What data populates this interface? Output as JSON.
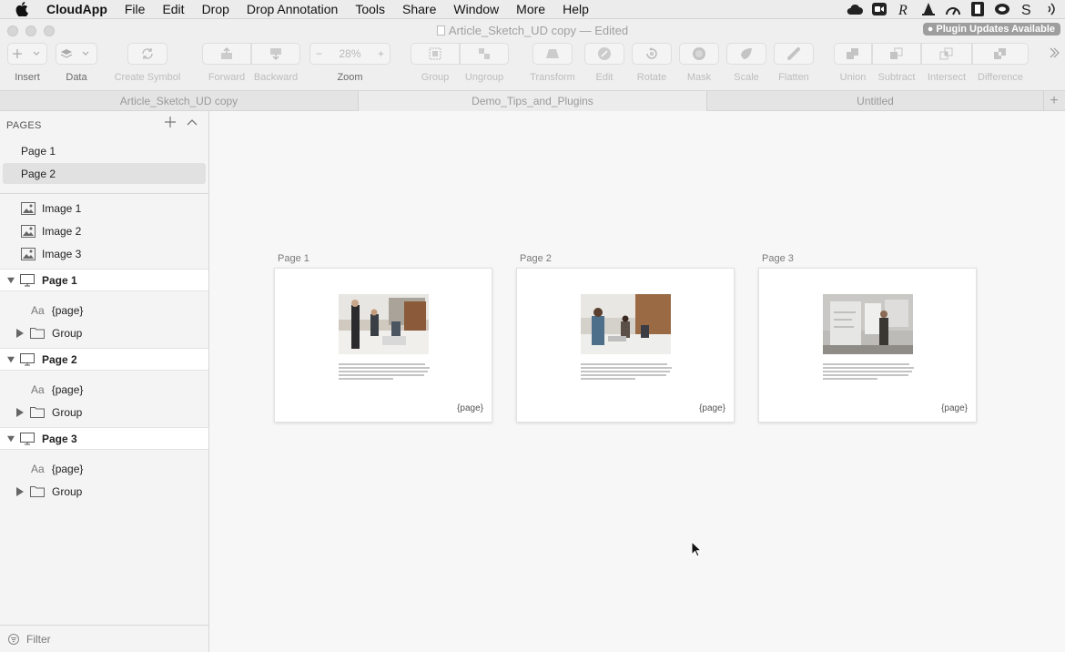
{
  "menubar": {
    "app_name": "CloudApp",
    "items": [
      "File",
      "Edit",
      "Drop",
      "Drop Annotation",
      "Tools",
      "Share",
      "Window",
      "More",
      "Help"
    ]
  },
  "window": {
    "title": "Article_Sketch_UD copy — Edited",
    "plugin_badge": "Plugin Updates Available"
  },
  "toolbar": {
    "insert": "Insert",
    "data": "Data",
    "create_symbol": "Create Symbol",
    "forward": "Forward",
    "backward": "Backward",
    "zoom_value": "28%",
    "zoom_minus": "−",
    "zoom_plus": "+",
    "zoom": "Zoom",
    "group": "Group",
    "ungroup": "Ungroup",
    "transform": "Transform",
    "edit": "Edit",
    "rotate": "Rotate",
    "mask": "Mask",
    "scale": "Scale",
    "flatten": "Flatten",
    "union": "Union",
    "subtract": "Subtract",
    "intersect": "Intersect",
    "difference": "Difference"
  },
  "tabs": {
    "t1": "Article_Sketch_UD copy",
    "t2": "Demo_Tips_and_Plugins",
    "t3": "Untitled",
    "active": "Demo_Tips_and_Plugins"
  },
  "sidebar": {
    "pages_header": "PAGES",
    "pages": [
      {
        "label": "Page 1",
        "selected": false
      },
      {
        "label": "Page 2",
        "selected": true
      }
    ],
    "images": [
      "Image 1",
      "Image 2",
      "Image 3"
    ],
    "artboards": [
      {
        "label": "Page 1",
        "text_layer": "{page}",
        "group": "Group"
      },
      {
        "label": "Page 2",
        "text_layer": "{page}",
        "group": "Group"
      },
      {
        "label": "Page 3",
        "text_layer": "{page}",
        "group": "Group"
      }
    ],
    "filter_placeholder": "Filter"
  },
  "canvas": {
    "artboards": [
      {
        "label": "Page 1",
        "tag": "{page}"
      },
      {
        "label": "Page 2",
        "tag": "{page}"
      },
      {
        "label": "Page 3",
        "tag": "{page}"
      }
    ]
  }
}
